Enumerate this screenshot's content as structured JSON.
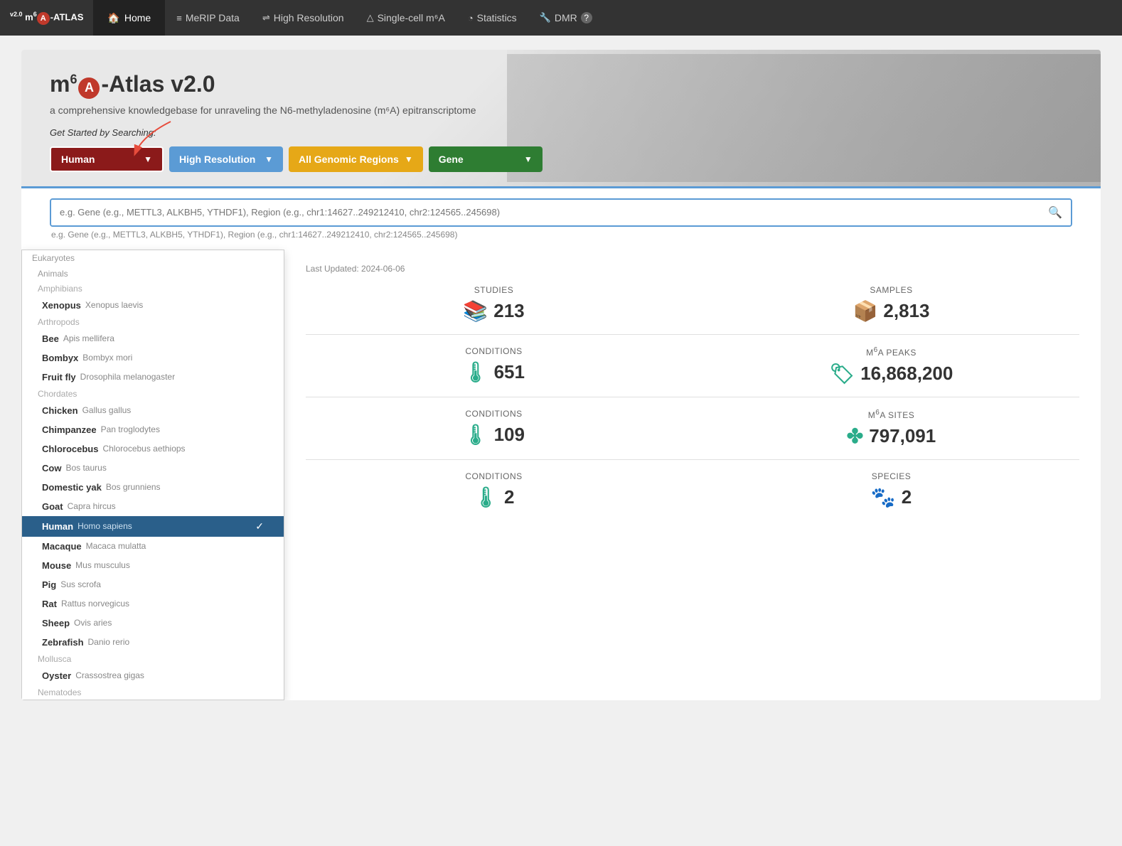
{
  "navbar": {
    "brand": "m⁶A-ATLAS",
    "version": "v2.0",
    "home_label": "Home",
    "nav_items": [
      {
        "id": "merip",
        "label": "MeRIP Data",
        "icon": "≡"
      },
      {
        "id": "highres",
        "label": "High Resolution",
        "icon": "⇌"
      },
      {
        "id": "singlecell",
        "label": "Single-cell m⁶A",
        "icon": "△"
      },
      {
        "id": "statistics",
        "label": "Statistics",
        "icon": "◔"
      },
      {
        "id": "dmr",
        "label": "DMR",
        "icon": "🔧"
      }
    ]
  },
  "hero": {
    "title_prefix": "m",
    "title_sup": "6",
    "title_suffix": "A-Atlas v2.0",
    "subtitle": "a comprehensive knowledgebase for unraveling the N6-methyladenosine (m⁶A) epitranscriptome",
    "search_label": "Get Started by Searching:",
    "dropdowns": {
      "species": "Human",
      "resolution": "High Resolution",
      "region": "All Genomic Regions",
      "gene": "Gene"
    }
  },
  "search": {
    "placeholder": "e.g. Gene (e.g., METTL3, ALKBH5, YTHDF1), Region (e.g., chr1:14627..249212410, chr2:124565..245698)"
  },
  "species_dropdown": {
    "groups": [
      {
        "label": "Eukaryotes",
        "children": [
          {
            "label": "Animals",
            "children": [
              {
                "label": "Amphibians",
                "items": [
                  {
                    "name": "Xenopus",
                    "sci": "Xenopus laevis",
                    "selected": false
                  }
                ]
              },
              {
                "label": "Arthropods",
                "items": [
                  {
                    "name": "Bee",
                    "sci": "Apis mellifera",
                    "selected": false
                  },
                  {
                    "name": "Bombyx",
                    "sci": "Bombyx mori",
                    "selected": false
                  },
                  {
                    "name": "Fruit fly",
                    "sci": "Drosophila melanogaster",
                    "selected": false
                  }
                ]
              },
              {
                "label": "Chordates",
                "items": [
                  {
                    "name": "Chicken",
                    "sci": "Gallus gallus",
                    "selected": false
                  },
                  {
                    "name": "Chimpanzee",
                    "sci": "Pan troglodytes",
                    "selected": false
                  },
                  {
                    "name": "Chlorocebus",
                    "sci": "Chlorocebus aethiops",
                    "selected": false
                  },
                  {
                    "name": "Cow",
                    "sci": "Bos taurus",
                    "selected": false
                  },
                  {
                    "name": "Domestic yak",
                    "sci": "Bos grunniens",
                    "selected": false
                  },
                  {
                    "name": "Goat",
                    "sci": "Capra hircus",
                    "selected": false
                  },
                  {
                    "name": "Human",
                    "sci": "Homo sapiens",
                    "selected": true
                  },
                  {
                    "name": "Macaque",
                    "sci": "Macaca mulatta",
                    "selected": false
                  },
                  {
                    "name": "Mouse",
                    "sci": "Mus musculus",
                    "selected": false
                  },
                  {
                    "name": "Pig",
                    "sci": "Sus scrofa",
                    "selected": false
                  },
                  {
                    "name": "Rat",
                    "sci": "Rattus norvegicus",
                    "selected": false
                  },
                  {
                    "name": "Sheep",
                    "sci": "Ovis aries",
                    "selected": false
                  },
                  {
                    "name": "Zebrafish",
                    "sci": "Danio rerio",
                    "selected": false
                  }
                ]
              },
              {
                "label": "Mollusca",
                "items": [
                  {
                    "name": "Oyster",
                    "sci": "Crassostrea gigas",
                    "selected": false
                  }
                ]
              },
              {
                "label": "Nematodes",
                "items": []
              }
            ]
          }
        ]
      }
    ]
  },
  "stats": {
    "last_updated": "Last Updated: 2024-06-06",
    "merip": {
      "studies_label": "STUDIES",
      "studies_value": "213",
      "samples_label": "SAMPLES",
      "samples_value": "2,813"
    },
    "highres": {
      "conditions_label": "Conditions",
      "conditions_value": "651",
      "peaks_label": "m⁶A Peaks",
      "peaks_value": "16,868,200"
    },
    "singlecell": {
      "conditions_label": "Conditions",
      "conditions_value": "109",
      "sites_label": "m⁶A Sites",
      "sites_value": "797,091"
    },
    "mollusca": {
      "conditions_label": "Conditions",
      "conditions_value": "2",
      "species_label": "Species",
      "species_value": "2"
    }
  }
}
